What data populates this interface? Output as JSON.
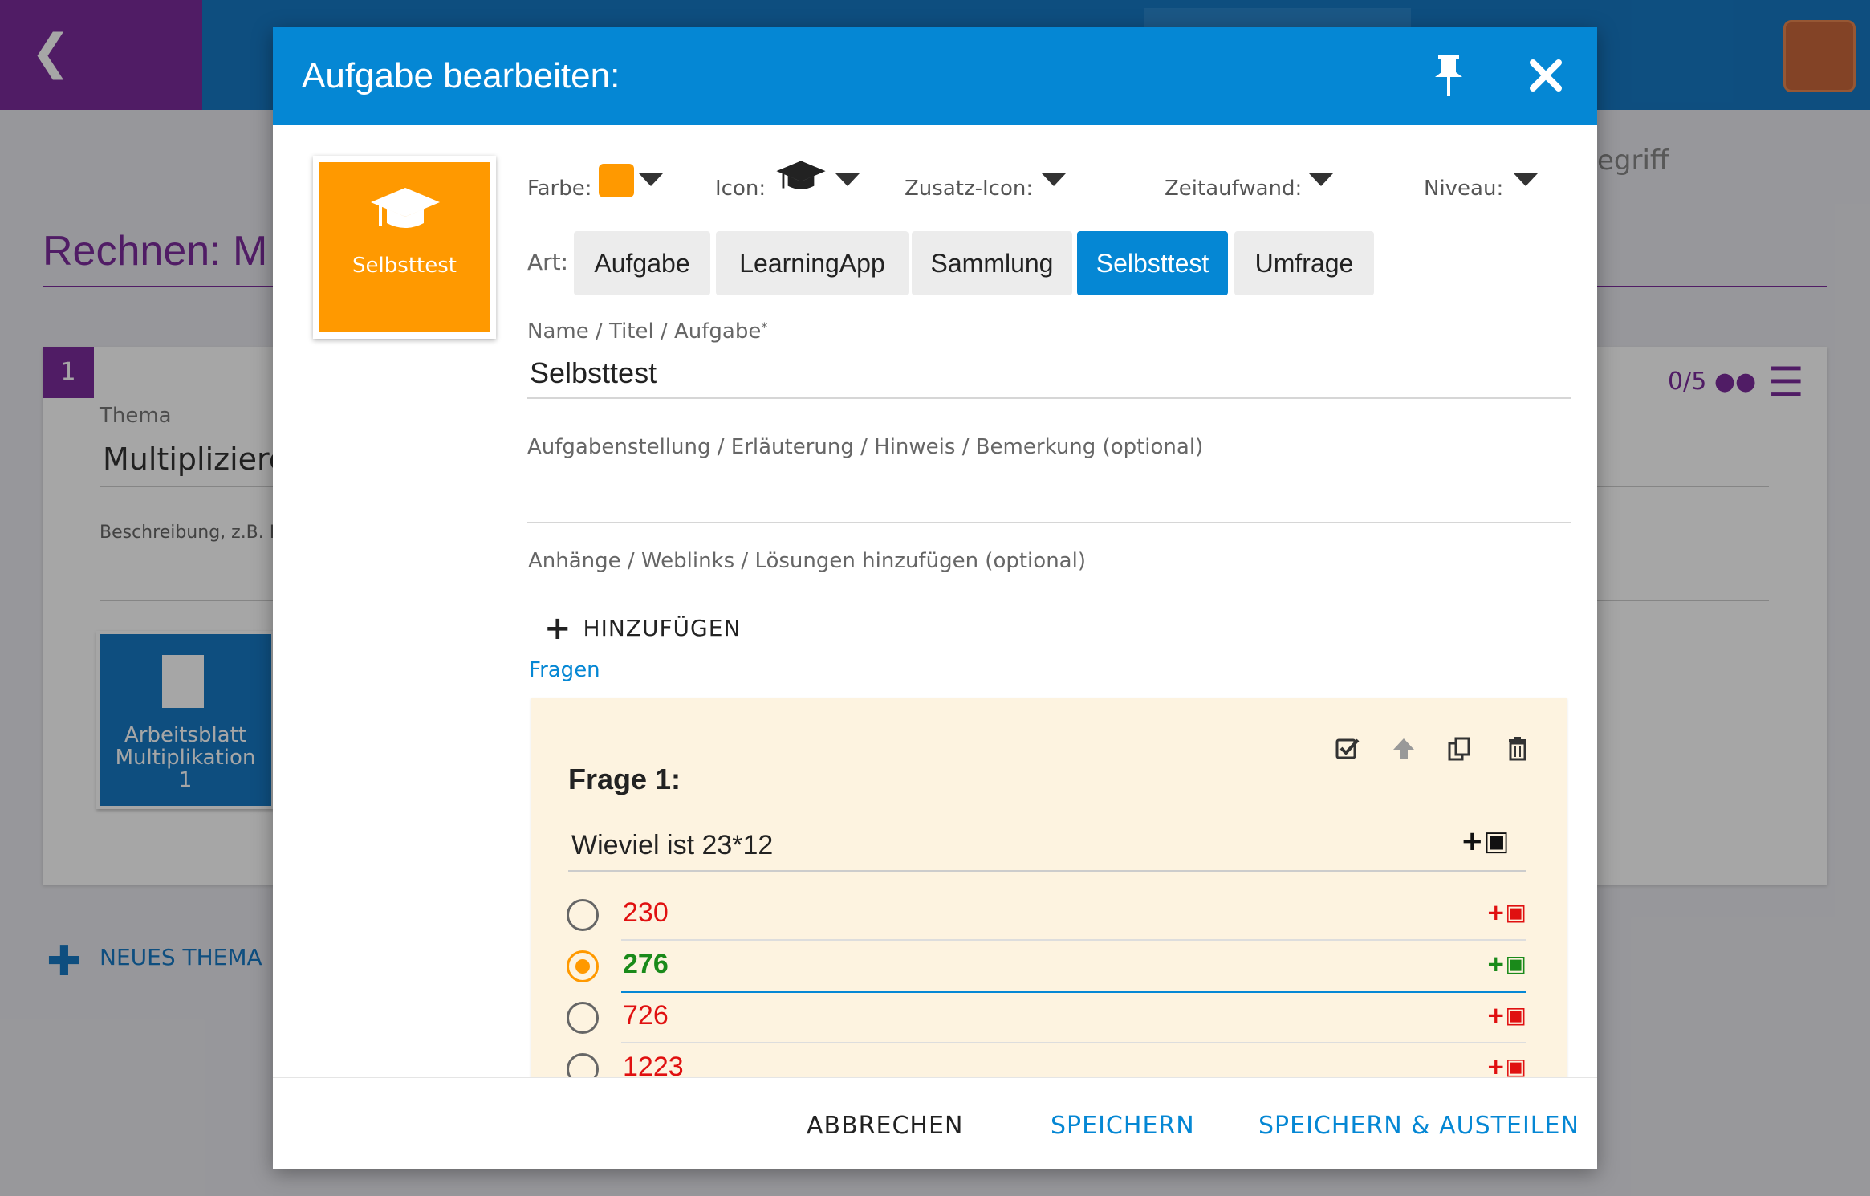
{
  "background": {
    "title": "Rechnen: M",
    "search_placeholder": "egriff",
    "topic_number": "1",
    "thema_label": "Thema",
    "thema_value": "Multipliziere",
    "description_placeholder": "Beschreibung, z.B. L",
    "count": "0/5",
    "tile_label_1": "Arbeitsblatt",
    "tile_label_2": "Multiplikation",
    "tile_label_3": "1",
    "new_topic": "NEUES THEMA"
  },
  "dialog": {
    "title": "Aufgabe bearbeiten:",
    "preview_label": "Selbsttest",
    "options": {
      "farbe": "Farbe:",
      "icon": "Icon:",
      "zusatz_icon": "Zusatz-Icon:",
      "zeitaufwand": "Zeitaufwand:",
      "niveau": "Niveau:"
    },
    "art_label": "Art:",
    "art_types": [
      "Aufgabe",
      "LearningApp",
      "Sammlung",
      "Selbsttest",
      "Umfrage"
    ],
    "name_label": "Name / Titel / Aufgabe",
    "name_required": "*",
    "name_value": "Selbsttest",
    "desc_label": "Aufgabenstellung / Erläuterung / Hinweis / Bemerkung (optional)",
    "attach_label": "Anhänge / Weblinks / Lösungen hinzufügen (optional)",
    "add_label": "HINZUFÜGEN",
    "fragen_label": "Fragen",
    "question": {
      "title": "Frage 1:",
      "text": "Wieviel ist 23*12",
      "answers": [
        "230",
        "276",
        "726",
        "1223"
      ],
      "correct_index": 1
    },
    "footer": {
      "cancel": "ABBRECHEN",
      "save": "SPEICHERN",
      "save_share": "SPEICHERN & AUSTEILEN"
    }
  },
  "colors": {
    "accent": "#0587d4",
    "selected_color": "#ff9900",
    "wrong": "#e01010",
    "correct": "#1a8a1a"
  }
}
